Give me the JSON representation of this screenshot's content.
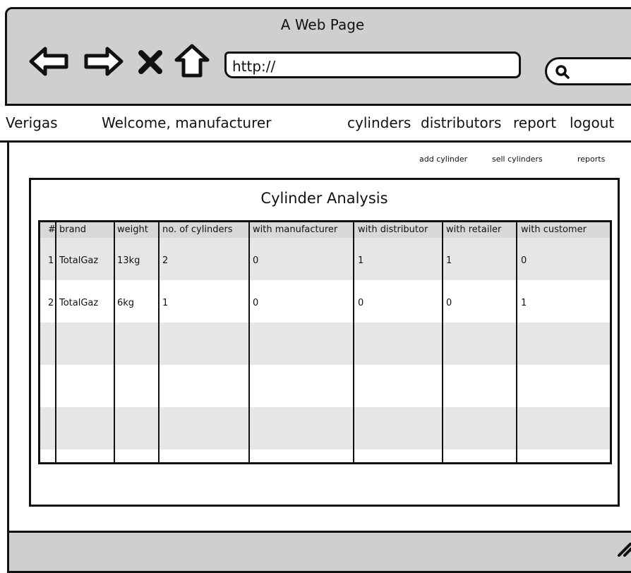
{
  "browser": {
    "title": "A Web Page",
    "url": "http://"
  },
  "appbar": {
    "brand": "Verigas",
    "welcome": "Welcome, manufacturer",
    "menu": [
      "cylinders",
      "distributors",
      "report",
      "logout"
    ]
  },
  "sublinks": [
    "add cylinder",
    "sell cylinders",
    "reports"
  ],
  "panel": {
    "title": "Cylinder Analysis"
  },
  "table": {
    "columns": [
      "#",
      "brand",
      "weight",
      "no. of cylinders",
      "with manufacturer",
      "with distributor",
      "with retailer",
      "with customer"
    ],
    "rows": [
      [
        "1",
        "TotalGaz",
        "13kg",
        "2",
        "0",
        "1",
        "1",
        "0"
      ],
      [
        "2",
        "TotalGaz",
        "6kg",
        "1",
        "0",
        "0",
        "0",
        "1"
      ]
    ],
    "row_colors": [
      "#e6e6e6",
      "#ffffff",
      "#e6e6e6",
      "#ffffff",
      "#e6e6e6"
    ]
  },
  "icons": {
    "back": "back-arrow-icon",
    "forward": "forward-arrow-icon",
    "stop": "close-icon",
    "home": "home-icon",
    "search": "search-icon",
    "resize": "resize-grip-icon"
  }
}
